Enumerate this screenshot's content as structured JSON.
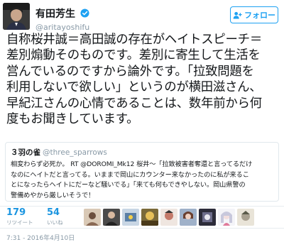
{
  "author": {
    "display_name": "有田芳生",
    "username": "@aritayoshifu",
    "avatar_icon": "profile-photo",
    "verified_icon": "verified-badge-icon"
  },
  "follow_button": {
    "label": "フォロー",
    "icon": "follow-person-plus-icon",
    "color": "#1da1f2"
  },
  "tweet_text": "自称桜井誠＝高田誠の存在がヘイトスピーチ＝\n差別煽動そのものです。差別に寄生して生活を\n営んでいるのですから論外です。「拉致問題を\n利用しないで欲しい」というのが横田滋さん、\n早紀江さんの心情であることは、数年前から何\n度もお聞きしています。",
  "quoted_tweet": {
    "display_name": "３羽の雀",
    "username": "@three_sparrows",
    "text": "相変わらず必死か。 RT @DOROMI_Mk12 桜井～「拉致被害者奪還と言ってるだけ\nなのにヘイトだと言ってる。いままで岡山にカウンター来なかったのに私が来るこ\nとになったらヘイトにだーなど騒いでる」「来ても何もできやしない。岡山県警の\n警備めやから厳しいそうで！"
  },
  "stats": {
    "retweet_count": "179",
    "retweet_label": "リツイート",
    "like_count": "54",
    "like_label": "いいね"
  },
  "likers": [
    {
      "icon": "liker-avatar-1"
    },
    {
      "icon": "liker-avatar-2"
    },
    {
      "icon": "liker-avatar-3"
    },
    {
      "icon": "liker-avatar-4"
    },
    {
      "icon": "liker-avatar-5"
    },
    {
      "icon": "liker-avatar-6"
    },
    {
      "icon": "liker-avatar-7"
    },
    {
      "icon": "liker-avatar-8"
    },
    {
      "icon": "liker-avatar-9"
    }
  ],
  "timestamp": "7:31 - 2016年4月10日",
  "colors": {
    "link_blue": "#1b95e0",
    "muted_gray": "#8899a6",
    "border": "#e1e8ed"
  }
}
